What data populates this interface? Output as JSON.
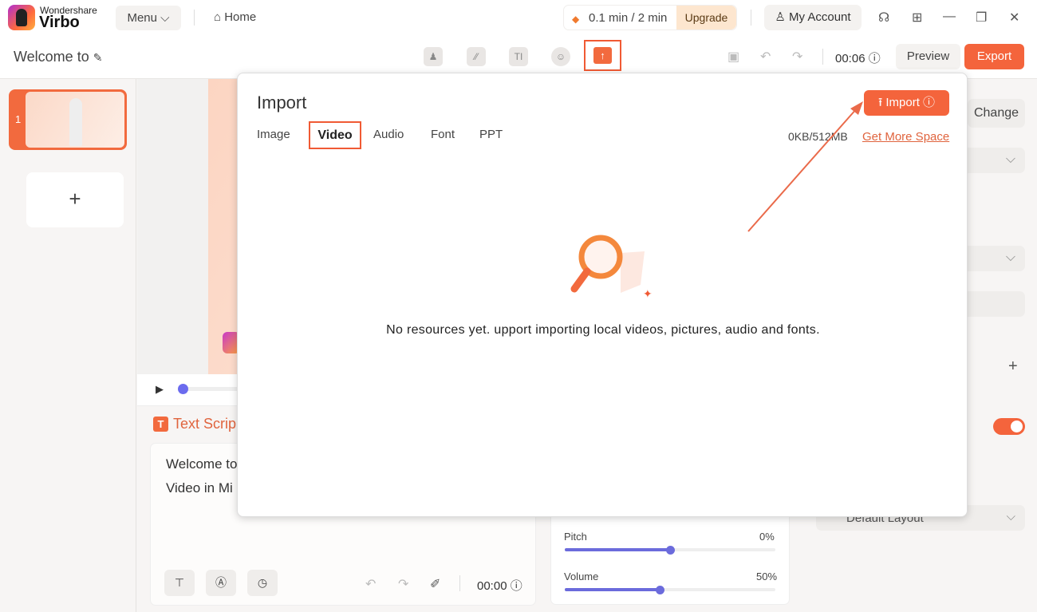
{
  "app": {
    "brand_top": "Wondershare",
    "brand_name": "Virbo",
    "menu": "Menu ⌵",
    "home": "⌂ Home",
    "usage": "0.1 min / 2 min",
    "upgrade": "Upgrade",
    "account": "♙ My Account"
  },
  "project": {
    "title": "Welcome to",
    "time": "00:06",
    "preview": "Preview",
    "export": "Export"
  },
  "toolbar_icons": [
    "avatar-icon",
    "background-icon",
    "text-icon",
    "sticker-icon",
    "import-folder-icon"
  ],
  "slides": [
    {
      "number": "1"
    }
  ],
  "add_slide": "+",
  "script": {
    "header": "Text Scrip",
    "header_icon": "T",
    "lines": [
      "Welcome to",
      "Video in Mi"
    ],
    "time": "00:00"
  },
  "voice": {
    "pitch_label": "Pitch",
    "pitch_value": "0%",
    "pitch_level": 0.5,
    "volume_label": "Volume",
    "volume_value": "50%",
    "volume_level": 0.45
  },
  "right_panel": {
    "change": "Change",
    "layout": "Default Layout",
    "toggle_on": true,
    "add": "+"
  },
  "import_dialog": {
    "title": "Import",
    "tabs": [
      "Image",
      "Video",
      "Audio",
      "Font",
      "PPT"
    ],
    "selected_tab": "Video",
    "import_button": "⭱ Import ⓘ",
    "storage": "0KB/512MB",
    "get_more": "Get More Space",
    "empty_message": "No resources yet. upport importing local videos, pictures, audio and fonts."
  },
  "colors": {
    "accent": "#f4643c",
    "slider": "#6b6bdc"
  }
}
